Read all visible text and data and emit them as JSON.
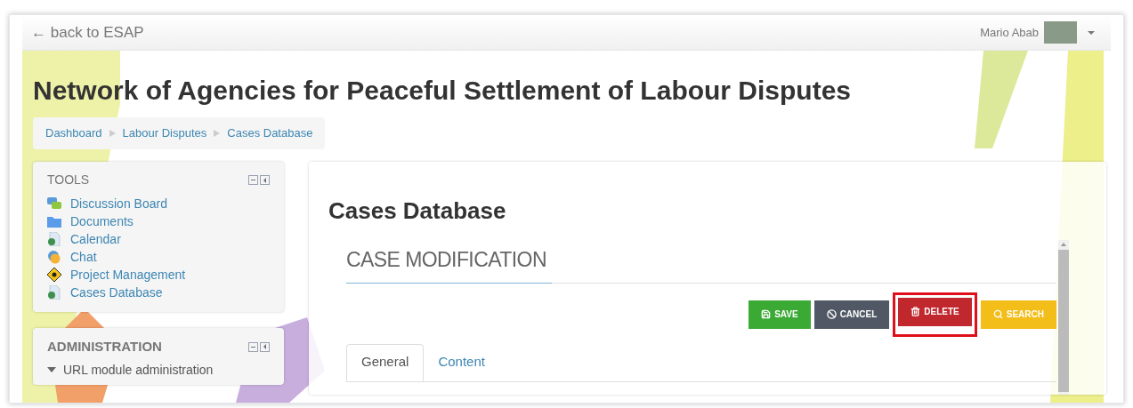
{
  "topbar": {
    "back_link": "← back to ESAP",
    "user_name": "Mario Abab"
  },
  "site_title": "Network of Agencies for Peaceful Settlement of Labour Disputes",
  "breadcrumb": [
    "Dashboard",
    "Labour Disputes",
    "Cases Database"
  ],
  "tools": {
    "title": "TOOLS",
    "items": [
      {
        "label": "Discussion Board",
        "kind": "forum"
      },
      {
        "label": "Documents",
        "kind": "folder"
      },
      {
        "label": "Calendar",
        "kind": "page"
      },
      {
        "label": "Chat",
        "kind": "chat"
      },
      {
        "label": "Project Management",
        "kind": "project"
      },
      {
        "label": "Cases Database",
        "kind": "page"
      }
    ]
  },
  "administration": {
    "title": "ADMINISTRATION",
    "items": [
      {
        "label": "URL module administration",
        "expanded": true
      }
    ]
  },
  "main": {
    "title": "Cases Database",
    "section": "CASE MODIFICATION",
    "buttons": [
      {
        "label": "SAVE",
        "kind": "save",
        "highlighted": false
      },
      {
        "label": "CANCEL",
        "kind": "cancel",
        "highlighted": false
      },
      {
        "label": "DELETE",
        "kind": "delete",
        "highlighted": true
      },
      {
        "label": "SEARCH",
        "kind": "search",
        "highlighted": false
      }
    ],
    "tabs": [
      {
        "label": "General",
        "selected": true
      },
      {
        "label": "Content",
        "selected": false
      }
    ]
  }
}
